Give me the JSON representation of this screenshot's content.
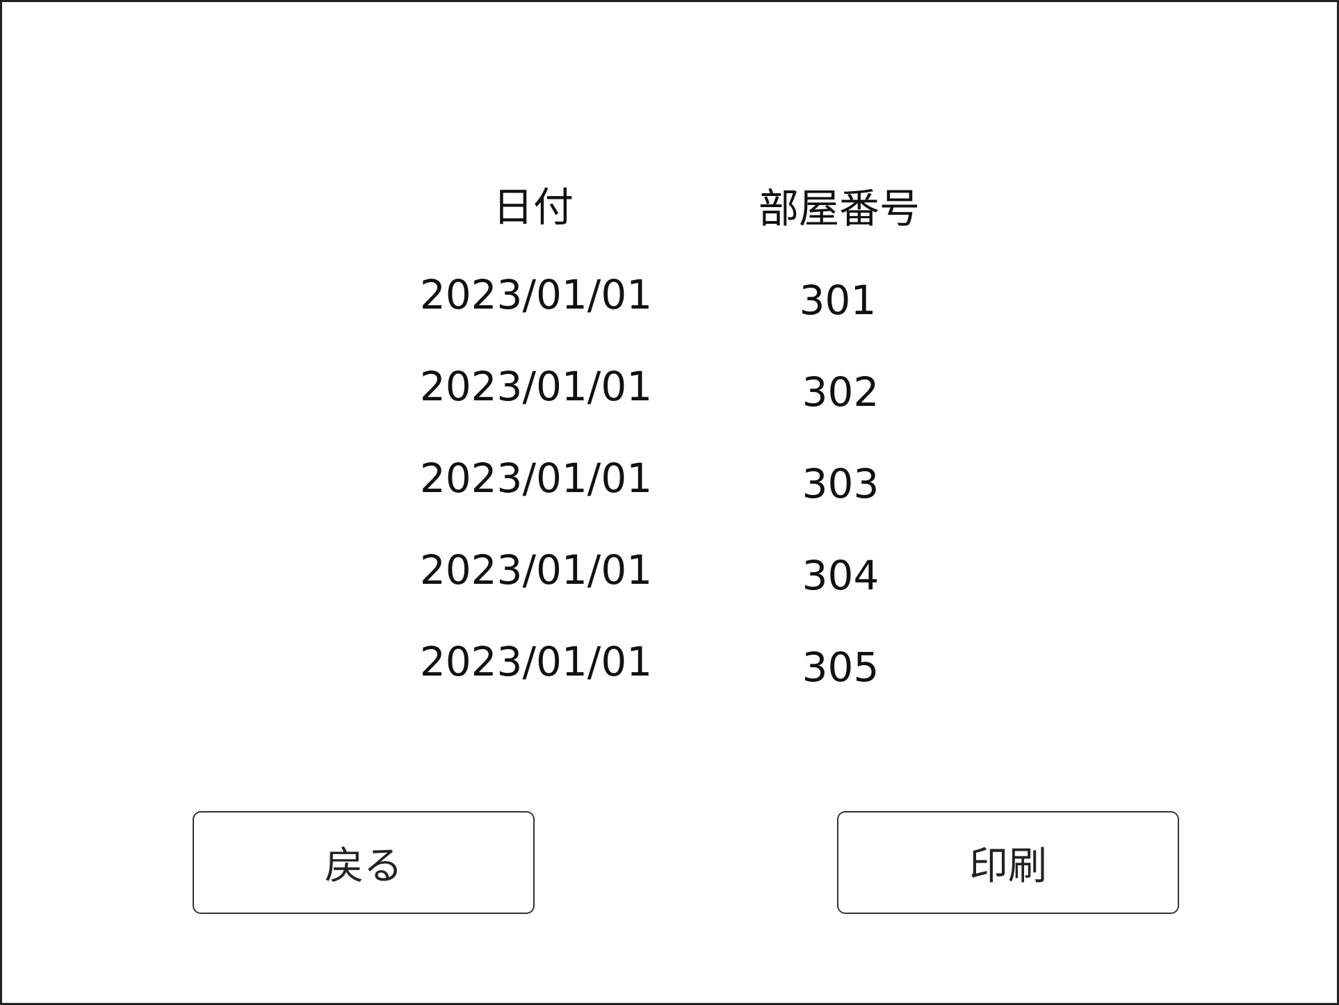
{
  "table": {
    "headers": {
      "date": "日付",
      "room_number": "部屋番号"
    },
    "rows": [
      {
        "date": "2023/01/01",
        "room": "301"
      },
      {
        "date": "2023/01/01",
        "room": "302"
      },
      {
        "date": "2023/01/01",
        "room": "303"
      },
      {
        "date": "2023/01/01",
        "room": "304"
      },
      {
        "date": "2023/01/01",
        "room": "305"
      }
    ]
  },
  "buttons": {
    "back_label": "戻る",
    "print_label": "印刷"
  }
}
